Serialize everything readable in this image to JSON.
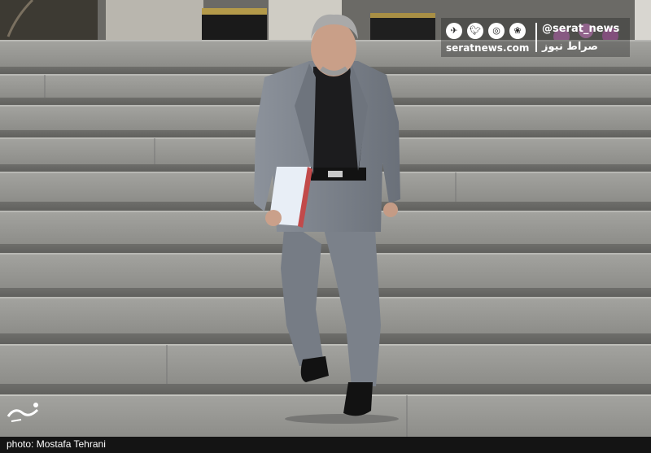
{
  "watermark": {
    "handle": "@serat_news",
    "site": "seratnews.com",
    "persian_name": "صراط نیوز",
    "icons": [
      "telegram-icon",
      "twitter-icon",
      "instagram-icon",
      "aparat-icon"
    ]
  },
  "caption": {
    "credit": "photo: Mostafa Tehrani"
  },
  "colors": {
    "steps": "#8e8e8b",
    "suit": "#7f858e",
    "shirt": "#1c1c1e",
    "caption_bar": "#141414"
  }
}
